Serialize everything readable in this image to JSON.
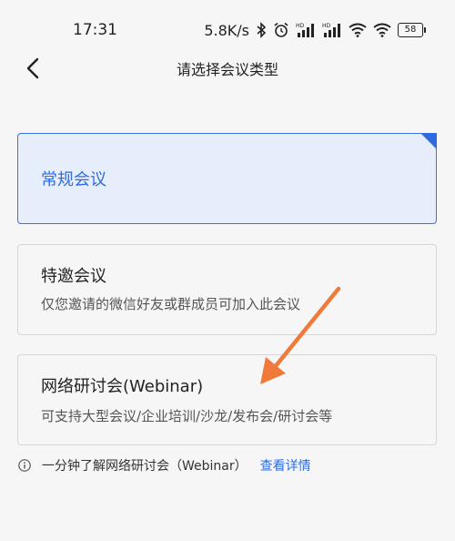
{
  "status_bar": {
    "time": "17:31",
    "network_speed": "5.8K/s",
    "battery_level": "58",
    "icons": [
      "bluetooth-icon",
      "alarm-icon",
      "signal-hd-icon",
      "signal-hd-icon",
      "wifi-icon",
      "wifi-icon",
      "battery-icon"
    ]
  },
  "nav": {
    "title": "请选择会议类型",
    "back_icon": "chevron-left-icon"
  },
  "meeting_types": [
    {
      "title": "常规会议",
      "description": "",
      "selected": true
    },
    {
      "title": "特邀会议",
      "description": "仅您邀请的微信好友或群成员可加入此会议",
      "selected": false
    },
    {
      "title": "网络研讨会(Webinar)",
      "description": "可支持大型会议/企业培训/沙龙/发布会/研讨会等",
      "selected": false
    }
  ],
  "info": {
    "text": "一分钟了解网络研讨会（Webinar）",
    "link": "查看详情",
    "icon": "info-icon"
  },
  "annotation": {
    "icon": "arrow-annotation-icon",
    "color": "#f07a3a"
  },
  "colors": {
    "accent": "#2f6be0",
    "selected_bg": "#e6eefc",
    "background": "#f6f6f6"
  }
}
